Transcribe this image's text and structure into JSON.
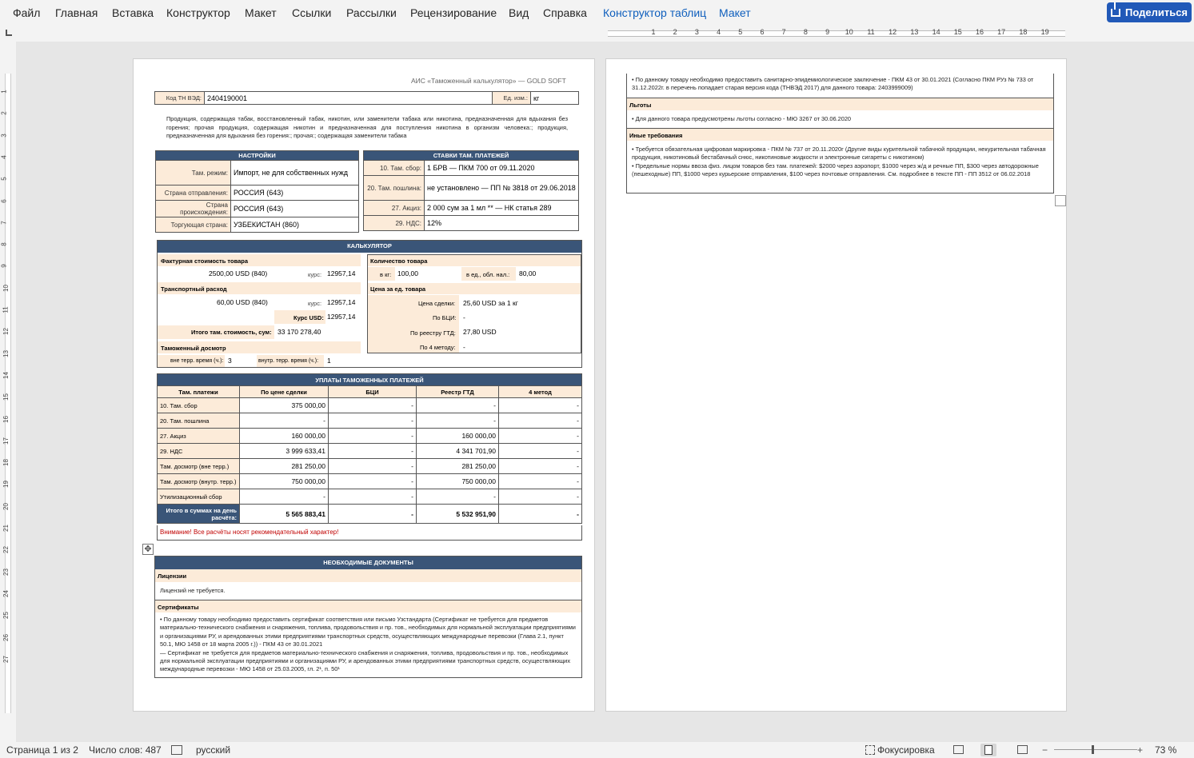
{
  "menu": [
    "Файл",
    "Главная",
    "Вставка",
    "Конструктор",
    "Макет",
    "Ссылки",
    "Рассылки",
    "Рецензирование",
    "Вид",
    "Справка"
  ],
  "context_tabs": [
    "Конструктор таблиц",
    "Макет"
  ],
  "share_label": "Поделиться",
  "ruler_h": [
    "1",
    "2",
    "3",
    "4",
    "5",
    "6",
    "7",
    "8",
    "9",
    "10",
    "11",
    "12",
    "13",
    "14",
    "15",
    "16",
    "17",
    "18",
    "19"
  ],
  "ruler_v": [
    "1",
    "2",
    "3",
    "4",
    "5",
    "6",
    "7",
    "8",
    "9",
    "10",
    "11",
    "12",
    "13",
    "14",
    "15",
    "16",
    "17",
    "18",
    "19",
    "20",
    "21",
    "22",
    "23",
    "24",
    "25",
    "26",
    "27"
  ],
  "doc": {
    "header": "АИС «Таможенный калькулятор» — GOLD SOFT",
    "code_label": "Код ТН ВЭД:",
    "code_value": "2404190001",
    "unit_label": "Ед. изм.:",
    "unit_value": "кг",
    "description": "Продукция, содержащая табак, восстановленный табак, никотин, или заменители табака или никотина, предназначенная для вдыхания без горения; прочая продукция, содержащая никотин и предназначенная для поступления никотина в организм человека:; продукция, предназначенная для вдыхания без горения:; прочая:; содержащая заменители табака",
    "settings": {
      "title": "НАСТРОЙКИ",
      "rows": [
        {
          "label": "Там. режим:",
          "value": "Импорт, не для собственных нужд"
        },
        {
          "label": "Страна отправления:",
          "value": "РОССИЯ (643)"
        },
        {
          "label": "Страна происхождения:",
          "value": "РОССИЯ (643)"
        },
        {
          "label": "Торгующая страна:",
          "value": "УЗБЕКИСТАН (860)"
        }
      ]
    },
    "rates": {
      "title": "СТАВКИ ТАМ. ПЛАТЕЖЕЙ",
      "rows": [
        {
          "label": "10. Там. сбор:",
          "value": "1 БРВ — ПКМ 700 от 09.11.2020"
        },
        {
          "label": "20. Там. пошлина:",
          "value": "не установлено — ПП № 3818 от 29.06.2018"
        },
        {
          "label": "27. Акциз:",
          "value": "2 000 сум за 1 мл ** — НК статья 289"
        },
        {
          "label": "29. НДС:",
          "value": "12%"
        }
      ]
    },
    "calc": {
      "title": "КАЛЬКУЛЯТОР",
      "invoice_label": "Фактурная стоимость товара",
      "invoice_value": "2500,00 USD (840)",
      "rate_label": "курс:",
      "invoice_rate": "12957,14",
      "transport_label": "Транспортный расход",
      "transport_value": "60,00 USD (840)",
      "transport_rate": "12957,14",
      "usd_rate_label": "Курс USD:",
      "usd_rate": "12957,14",
      "total_label": "Итого там. стоимость, сум:",
      "total_value": "33 170 278,40",
      "inspection_label": "Таможенный досмотр",
      "insp_out_label": "вне терр. время (ч.):",
      "insp_out_value": "3",
      "insp_in_label": "внутр. терр. время (ч.):",
      "insp_in_value": "1",
      "qty_label": "Количество товара",
      "kg_label": "в кг:",
      "kg_value": "100,00",
      "unit_qty_label": "в ед., обл. нал.:",
      "unit_qty_value": "80,00",
      "price_label": "Цена за ед. товара",
      "deal_label": "Цена сделки:",
      "deal_value": "25,60 USD за 1 кг",
      "bci_label": "По БЦИ:",
      "bci_value": "-",
      "gtd_label": "По реестру ГТД:",
      "gtd_value": "27,80 USD",
      "m4_label": "По 4 методу:",
      "m4_value": "-"
    },
    "payments": {
      "title": "УПЛАТЫ ТАМОЖЕННЫХ ПЛАТЕЖЕЙ",
      "headers": [
        "Там. платежи",
        "По цене сделки",
        "БЦИ",
        "Реестр ГТД",
        "4 метод"
      ],
      "rows": [
        [
          "10. Там. сбор",
          "375 000,00",
          "-",
          "-",
          "-"
        ],
        [
          "20. Там. пошлина",
          "-",
          "-",
          "-",
          "-"
        ],
        [
          "27. Акциз",
          "160 000,00",
          "-",
          "160 000,00",
          "-"
        ],
        [
          "29. НДС",
          "3 999 633,41",
          "-",
          "4 341 701,90",
          "-"
        ],
        [
          "Там. досмотр (вне терр.)",
          "281 250,00",
          "-",
          "281 250,00",
          "-"
        ],
        [
          "Там. досмотр (внутр. терр.)",
          "750 000,00",
          "-",
          "750 000,00",
          "-"
        ],
        [
          "Утилизационный сбор",
          "-",
          "-",
          "-",
          "-"
        ]
      ],
      "total": [
        "Итого в суммах на день расчёта:",
        "5 565 883,41",
        "-",
        "5 532 951,90",
        "-"
      ],
      "warning": "Внимание! Все расчёты носят рекомендательный характер!"
    },
    "docs": {
      "title": "НЕОБХОДИМЫЕ ДОКУМЕНТЫ",
      "licenses_label": "Лицензии",
      "licenses_text": "Лицензий не требуется.",
      "certs_label": "Сертификаты",
      "certs_text": "• По данному товару необходимо предоставить сертификат соответствия или письмо Узстандарта (Сертификат не требуется для предметов материально-технического снабжения и снаряжения, топлива, продовольствия и пр. тов., необходимых для нормальной эксплуатации предприятиями и организациями РУ, и арендованных этими предприятиями транспортных средств, осуществляющих международные перевозки (Глава 2.1, пункт 50.1, МЮ 1458 от 18 марта 2005 г.)) - ПКМ 43 от 30.01.2021\n— Сертификат не требуется для предметов материально-технического снабжения и снаряжения, топлива, продовольствия и пр. тов., необходимых для нормальной эксплуатации предприятиями и организациями РУ, и арендованных этими предприятиями транспортных средств, осуществляющих международные перевозки - МЮ 1458 от 25.03.2005, гл. 2¹, п. 50¹"
    },
    "page2": {
      "sanitary_text": "• По данному товару необходимо предоставить санитарно-эпидемиологическое заключение - ПКМ 43 от 30.01.2021  (Согласно ПКМ РУз № 733 от 31.12.2022г. в перечень попадает старая версия кода (ТНВЭД 2017) для данного товара: 2403999009)",
      "benefits_label": "Льготы",
      "benefits_text": "• Для данного товара предусмотрены льготы согласно - МЮ 3267 от 30.06.2020",
      "other_label": "Иные требования",
      "other_text": "• Требуется обязательная цифровая маркировка - ПКМ № 737 от 20.11.2020г  (Другие виды курительной табачной продукции, некурительная табачная продукция, никотиновый бестабачный снюс, никотиновые жидкости и электронные сигареты с никотином)\n• Предельные нормы ввоза физ. лицом товаров без там. платежей: $2000 через аэропорт, $1000 через ж/д и речные ПП, $300 через автодорожные (пешеходные) ПП, $1000 через курьерские отправления, $100 через почтовые отправления. См. подробнее в тексте ПП - ПП 3512 от 06.02.2018"
    }
  },
  "status": {
    "page": "Страница 1 из 2",
    "words": "Число слов: 487",
    "lang": "русский",
    "focus": "Фокусировка",
    "zoom": "73 %"
  }
}
